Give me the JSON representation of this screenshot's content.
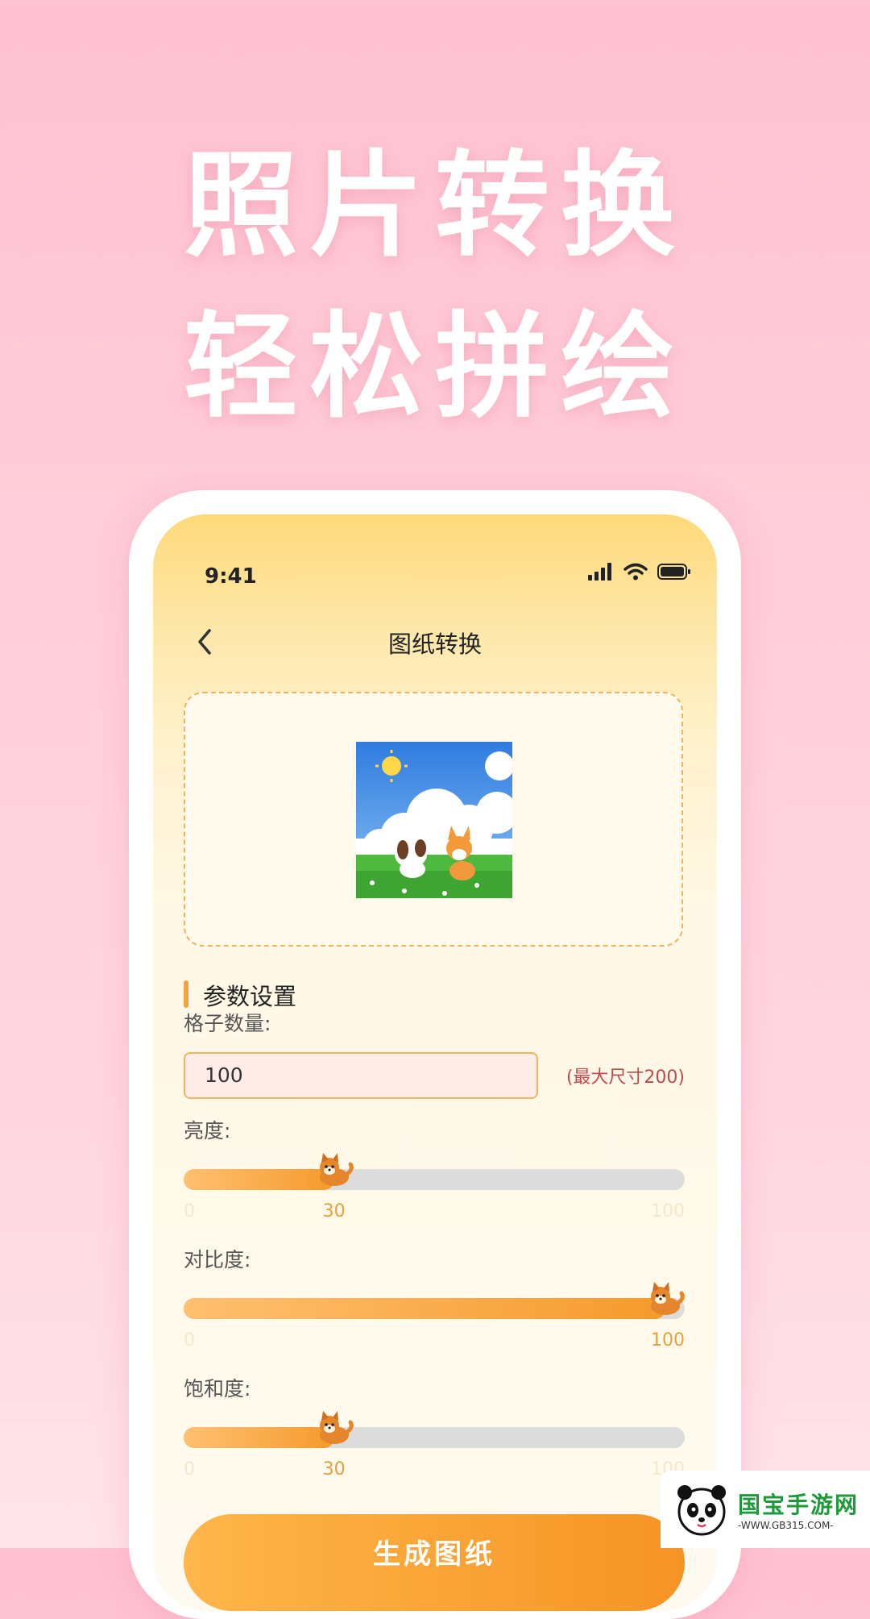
{
  "headline": {
    "line1": "照片转换",
    "line2": "轻松拼绘"
  },
  "status": {
    "time": "9:41"
  },
  "nav": {
    "title": "图纸转换"
  },
  "settings": {
    "section_title": "参数设置",
    "grid_label": "格子数量:",
    "grid_value": "100",
    "grid_hint": "(最大尺寸200)",
    "brightness": {
      "label": "亮度:",
      "min": "0",
      "value": "30",
      "max": "100"
    },
    "contrast": {
      "label": "对比度:",
      "min": "0",
      "value": "100",
      "max": "100"
    },
    "saturation": {
      "label": "饱和度:",
      "min": "0",
      "value": "30",
      "max": "100"
    }
  },
  "actions": {
    "generate_label": "生成图纸"
  },
  "watermark": {
    "brand": "国宝手游网",
    "url": "-WWW.GB315.COM-"
  },
  "colors": {
    "accent": "#f5a23c",
    "background": "#ffc2d2",
    "hint": "#c04a4a"
  }
}
